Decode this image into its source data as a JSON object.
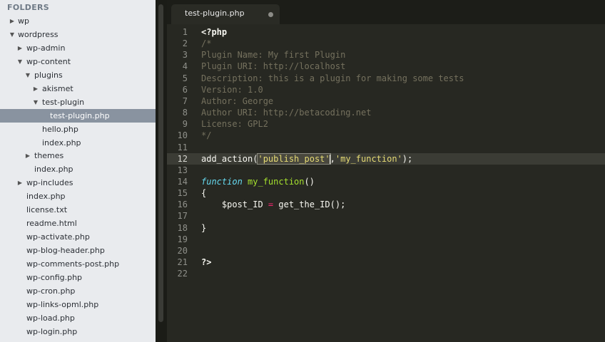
{
  "sidebar": {
    "header": "FOLDERS",
    "items": [
      {
        "label": "wp",
        "arrow": "▶"
      },
      {
        "label": "wordpress",
        "arrow": "▼"
      },
      {
        "label": "wp-admin",
        "arrow": "▶"
      },
      {
        "label": "wp-content",
        "arrow": "▼"
      },
      {
        "label": "plugins",
        "arrow": "▼"
      },
      {
        "label": "akismet",
        "arrow": "▶"
      },
      {
        "label": "test-plugin",
        "arrow": "▼"
      },
      {
        "label": "test-plugin.php",
        "arrow": ""
      },
      {
        "label": "hello.php",
        "arrow": ""
      },
      {
        "label": "index.php",
        "arrow": ""
      },
      {
        "label": "themes",
        "arrow": "▶"
      },
      {
        "label": "index.php",
        "arrow": ""
      },
      {
        "label": "wp-includes",
        "arrow": "▶"
      },
      {
        "label": "index.php",
        "arrow": ""
      },
      {
        "label": "license.txt",
        "arrow": ""
      },
      {
        "label": "readme.html",
        "arrow": ""
      },
      {
        "label": "wp-activate.php",
        "arrow": ""
      },
      {
        "label": "wp-blog-header.php",
        "arrow": ""
      },
      {
        "label": "wp-comments-post.php",
        "arrow": ""
      },
      {
        "label": "wp-config.php",
        "arrow": ""
      },
      {
        "label": "wp-cron.php",
        "arrow": ""
      },
      {
        "label": "wp-links-opml.php",
        "arrow": ""
      },
      {
        "label": "wp-load.php",
        "arrow": ""
      },
      {
        "label": "wp-login.php",
        "arrow": ""
      }
    ]
  },
  "tab": {
    "title": "test-plugin.php"
  },
  "editor": {
    "current_line": 12,
    "lines": [
      {
        "num": "1",
        "tokens": [
          {
            "t": "<?php",
            "c": "bold"
          }
        ]
      },
      {
        "num": "2",
        "tokens": [
          {
            "t": "/*",
            "c": "comment"
          }
        ]
      },
      {
        "num": "3",
        "tokens": [
          {
            "t": "Plugin Name: My first Plugin",
            "c": "comment"
          }
        ]
      },
      {
        "num": "4",
        "tokens": [
          {
            "t": "Plugin URI: http://localhost",
            "c": "comment"
          }
        ]
      },
      {
        "num": "5",
        "tokens": [
          {
            "t": "Description: this is a plugin for making some tests",
            "c": "comment"
          }
        ]
      },
      {
        "num": "6",
        "tokens": [
          {
            "t": "Version: 1.0",
            "c": "comment"
          }
        ]
      },
      {
        "num": "7",
        "tokens": [
          {
            "t": "Author: George",
            "c": "comment"
          }
        ]
      },
      {
        "num": "8",
        "tokens": [
          {
            "t": "Author URI: http://betacoding.net",
            "c": "comment"
          }
        ]
      },
      {
        "num": "9",
        "tokens": [
          {
            "t": "License: GPL2",
            "c": "comment"
          }
        ]
      },
      {
        "num": "10",
        "tokens": [
          {
            "t": "*/",
            "c": "comment"
          }
        ]
      },
      {
        "num": "11",
        "tokens": []
      },
      {
        "num": "12",
        "tokens": [
          {
            "t": "add_action(",
            "c": "plain"
          },
          {
            "t": "'publish_post'",
            "c": "sel"
          },
          {
            "t": "",
            "c": "caret"
          },
          {
            "t": ",",
            "c": "plain"
          },
          {
            "t": "'my_function'",
            "c": "string"
          },
          {
            "t": ");",
            "c": "plain"
          }
        ]
      },
      {
        "num": "13",
        "tokens": []
      },
      {
        "num": "14",
        "tokens": [
          {
            "t": "function",
            "c": "keyword"
          },
          {
            "t": " ",
            "c": "plain"
          },
          {
            "t": "my_function",
            "c": "func"
          },
          {
            "t": "()",
            "c": "plain"
          }
        ]
      },
      {
        "num": "15",
        "tokens": [
          {
            "t": "{",
            "c": "plain"
          }
        ]
      },
      {
        "num": "16",
        "tokens": [
          {
            "t": "    $post_ID ",
            "c": "plain"
          },
          {
            "t": "=",
            "c": "op"
          },
          {
            "t": " get_the_ID();",
            "c": "plain"
          }
        ]
      },
      {
        "num": "17",
        "tokens": []
      },
      {
        "num": "18",
        "tokens": [
          {
            "t": "}",
            "c": "plain"
          }
        ]
      },
      {
        "num": "19",
        "tokens": []
      },
      {
        "num": "20",
        "tokens": []
      },
      {
        "num": "21",
        "tokens": [
          {
            "t": "?>",
            "c": "bold"
          }
        ]
      },
      {
        "num": "22",
        "tokens": []
      }
    ]
  },
  "colors": {
    "editor_bg": "#272822",
    "sidebar_bg": "#e9ebee",
    "selected_file_bg": "#8993a0",
    "comment": "#75715e",
    "string": "#e6db74",
    "keyword": "#66d9ef",
    "function": "#a6e22e",
    "operator": "#f92672"
  }
}
